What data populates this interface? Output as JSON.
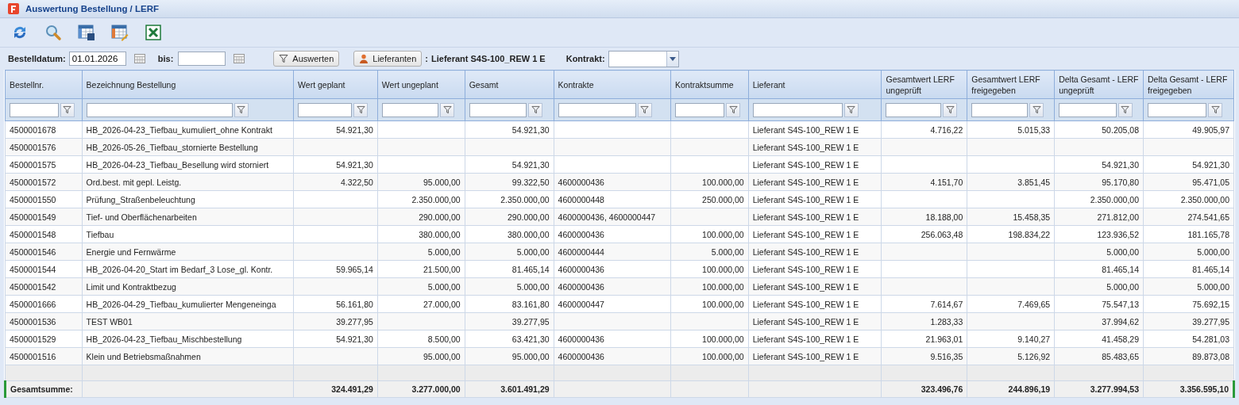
{
  "window": {
    "title": "Auswertung Bestellung / LERF"
  },
  "toolbar": [
    {
      "kind": "refresh"
    },
    {
      "kind": "search"
    },
    {
      "kind": "table-save"
    },
    {
      "kind": "table-edit"
    },
    {
      "kind": "excel"
    }
  ],
  "filter_bar": {
    "date_from_label": "Bestelldatum:",
    "date_from_value": "01.01.2026",
    "date_to_label": "bis:",
    "evaluate_button": "Auswerten",
    "suppliers_button": "Lieferanten",
    "supplier_separator": ":",
    "supplier_value": "Lieferant S4S-100_REW 1 E",
    "contract_label": "Kontrakt:"
  },
  "table": {
    "columns": [
      {
        "label": "Bestellnr.",
        "kind": "text"
      },
      {
        "label": "Bezeichnung Bestellung",
        "kind": "text"
      },
      {
        "label": "Wert geplant",
        "kind": "amount"
      },
      {
        "label": "Wert ungeplant",
        "kind": "amount"
      },
      {
        "label": "Gesamt",
        "kind": "amount"
      },
      {
        "label": "Kontrakte",
        "kind": "text"
      },
      {
        "label": "Kontraktsumme",
        "kind": "limit"
      },
      {
        "label": "Lieferant",
        "kind": "text"
      },
      {
        "label": "Gesamtwert LERF ungeprüft",
        "kind": "amount"
      },
      {
        "label": "Gesamtwert LERF freigegeben",
        "kind": "amount"
      },
      {
        "label": "Delta Gesamt - LERF ungeprüft",
        "kind": "amount"
      },
      {
        "label": "Delta Gesamt - LERF freigegeben",
        "kind": "amount"
      }
    ],
    "rows": [
      [
        "4500001678",
        "HB_2026-04-23_Tiefbau_kumuliert_ohne Kontrakt",
        "54.921,30",
        null,
        "54.921,30",
        null,
        null,
        "Lieferant S4S-100_REW 1 E",
        "4.716,22",
        "5.015,33",
        "50.205,08",
        "49.905,97"
      ],
      [
        "4500001576",
        "HB_2026-05-26_Tiefbau_stornierte Bestellung",
        null,
        null,
        null,
        null,
        null,
        "Lieferant S4S-100_REW 1 E",
        null,
        null,
        null,
        null
      ],
      [
        "4500001575",
        "HB_2026-04-23_Tiefbau_Besellung wird storniert",
        "54.921,30",
        null,
        "54.921,30",
        null,
        null,
        "Lieferant S4S-100_REW 1 E",
        null,
        null,
        "54.921,30",
        "54.921,30"
      ],
      [
        "4500001572",
        "Ord.best. mit gepl. Leistg.",
        "4.322,50",
        "95.000,00",
        "99.322,50",
        "4600000436",
        "100.000,00",
        "Lieferant S4S-100_REW 1 E",
        "4.151,70",
        "3.851,45",
        "95.170,80",
        "95.471,05"
      ],
      [
        "4500001550",
        "Prüfung_Straßenbeleuchtung",
        null,
        "2.350.000,00",
        "2.350.000,00",
        "4600000448",
        "250.000,00",
        "Lieferant S4S-100_REW 1 E",
        null,
        null,
        "2.350.000,00",
        "2.350.000,00"
      ],
      [
        "4500001549",
        "Tief- und Oberflächenarbeiten",
        null,
        "290.000,00",
        "290.000,00",
        "4600000436, 4600000447",
        null,
        "Lieferant S4S-100_REW 1 E",
        "18.188,00",
        "15.458,35",
        "271.812,00",
        "274.541,65"
      ],
      [
        "4500001548",
        "Tiefbau",
        null,
        "380.000,00",
        "380.000,00",
        "4600000436",
        "100.000,00",
        "Lieferant S4S-100_REW 1 E",
        "256.063,48",
        "198.834,22",
        "123.936,52",
        "181.165,78"
      ],
      [
        "4500001546",
        "Energie und Fernwärme",
        null,
        "5.000,00",
        "5.000,00",
        "4600000444",
        "5.000,00",
        "Lieferant S4S-100_REW 1 E",
        null,
        null,
        "5.000,00",
        "5.000,00"
      ],
      [
        "4500001544",
        "HB_2026-04-20_Start im Bedarf_3 Lose_gl. Kontr.",
        "59.965,14",
        "21.500,00",
        "81.465,14",
        "4600000436",
        "100.000,00",
        "Lieferant S4S-100_REW 1 E",
        null,
        null,
        "81.465,14",
        "81.465,14"
      ],
      [
        "4500001542",
        "Limit und Kontraktbezug",
        null,
        "5.000,00",
        "5.000,00",
        "4600000436",
        "100.000,00",
        "Lieferant S4S-100_REW 1 E",
        null,
        null,
        "5.000,00",
        "5.000,00"
      ],
      [
        "4500001666",
        "HB_2026-04-29_Tiefbau_kumulierter Mengeneinga",
        "56.161,80",
        "27.000,00",
        "83.161,80",
        "4600000447",
        "100.000,00",
        "Lieferant S4S-100_REW 1 E",
        "7.614,67",
        "7.469,65",
        "75.547,13",
        "75.692,15"
      ],
      [
        "4500001536",
        "TEST WB01",
        "39.277,95",
        null,
        "39.277,95",
        null,
        null,
        "Lieferant S4S-100_REW 1 E",
        "1.283,33",
        null,
        "37.994,62",
        "39.277,95"
      ],
      [
        "4500001529",
        "HB_2026-04-23_Tiefbau_Mischbestellung",
        "54.921,30",
        "8.500,00",
        "63.421,30",
        "4600000436",
        "100.000,00",
        "Lieferant S4S-100_REW 1 E",
        "21.963,01",
        "9.140,27",
        "41.458,29",
        "54.281,03"
      ],
      [
        "4500001516",
        "Klein und Betriebsmaßnahmen",
        null,
        "95.000,00",
        "95.000,00",
        "4600000436",
        "100.000,00",
        "Lieferant S4S-100_REW 1 E",
        "9.516,35",
        "5.126,92",
        "85.483,65",
        "89.873,08"
      ]
    ],
    "total": {
      "label": "Gesamtsumme:",
      "values": [
        "324.491,29",
        "3.277.000,00",
        "3.601.491,29",
        "323.496,76",
        "244.896,19",
        "3.277.994,53",
        "3.356.595,10"
      ]
    }
  }
}
